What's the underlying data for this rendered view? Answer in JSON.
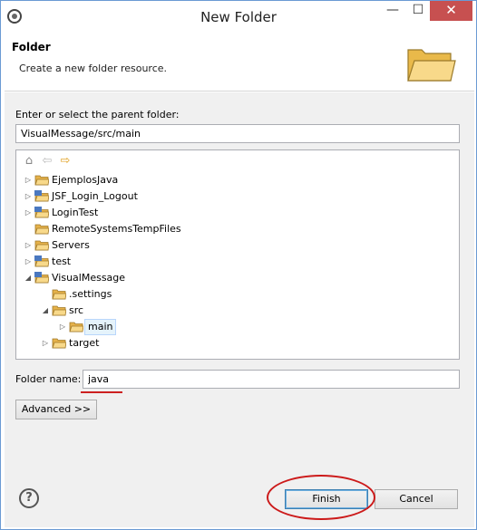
{
  "window": {
    "title": "New Folder",
    "min_glyph": "—",
    "max_glyph": "☐",
    "close_glyph": "✕"
  },
  "header": {
    "title": "Folder",
    "description": "Create a new folder resource."
  },
  "parent": {
    "label": "Enter or select the parent folder:",
    "value": "VisualMessage/src/main"
  },
  "tree": {
    "toolbar": [
      "home-icon",
      "back-icon",
      "forward-icon"
    ],
    "items": [
      {
        "label": "EjemplosJava",
        "expander": "▷",
        "icon": "folder"
      },
      {
        "label": "JSF_Login_Logout",
        "expander": "▷",
        "icon": "project"
      },
      {
        "label": "LoginTest",
        "expander": "▷",
        "icon": "project"
      },
      {
        "label": "RemoteSystemsTempFiles",
        "expander": "",
        "icon": "folder"
      },
      {
        "label": "Servers",
        "expander": "▷",
        "icon": "folder"
      },
      {
        "label": "test",
        "expander": "▷",
        "icon": "project"
      },
      {
        "label": "VisualMessage",
        "expander": "◢",
        "icon": "project"
      },
      {
        "label": ".settings",
        "expander": "",
        "icon": "folder"
      },
      {
        "label": "src",
        "expander": "◢",
        "icon": "folder"
      },
      {
        "label": "main",
        "expander": "▷",
        "icon": "folder",
        "selected": true
      },
      {
        "label": "target",
        "expander": "▷",
        "icon": "folder"
      }
    ]
  },
  "folder_name": {
    "label": "Folder name:",
    "value": "java"
  },
  "buttons": {
    "advanced": "Advanced >>",
    "finish": "Finish",
    "cancel": "Cancel",
    "help": "?"
  },
  "colors": {
    "highlight": "#cc1a1a",
    "selection": "#e5f3fb",
    "folder": "#f5c55a"
  }
}
